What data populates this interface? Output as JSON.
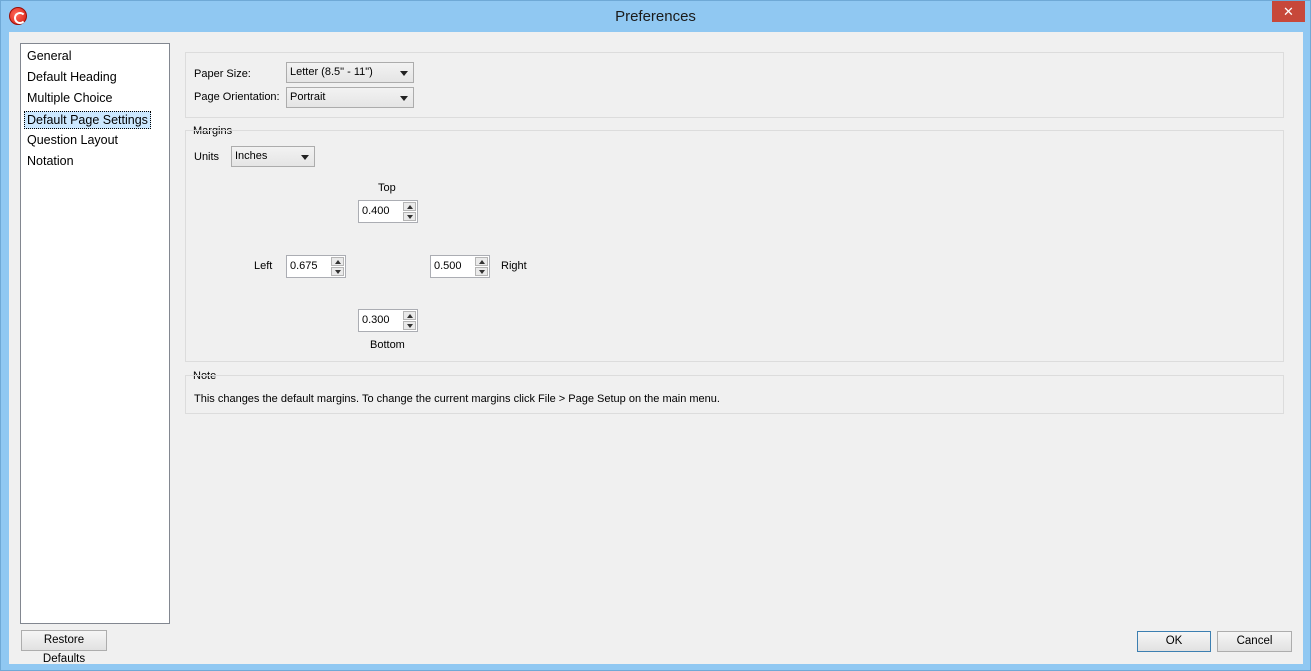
{
  "window": {
    "title": "Preferences",
    "close_glyph": "✕"
  },
  "sidebar": {
    "items": [
      {
        "label": "General"
      },
      {
        "label": "Default Heading"
      },
      {
        "label": "Multiple Choice"
      },
      {
        "label": "Default Page Settings",
        "selected": true
      },
      {
        "label": "Question Layout"
      },
      {
        "label": "Notation"
      }
    ]
  },
  "page": {
    "paper_size_label": "Paper Size:",
    "paper_size_value": "Letter (8.5\" - 11\")",
    "orientation_label": "Page Orientation:",
    "orientation_value": "Portrait"
  },
  "margins": {
    "group_title": "Margins",
    "units_label": "Units",
    "units_value": "Inches",
    "top_label": "Top",
    "top_value": "0.400",
    "left_label": "Left",
    "left_value": "0.675",
    "right_label": "Right",
    "right_value": "0.500",
    "bottom_label": "Bottom",
    "bottom_value": "0.300"
  },
  "note": {
    "title": "Note",
    "text": "This changes the default margins.  To change the current margins click File > Page Setup on the main menu."
  },
  "buttons": {
    "restore_defaults": "Restore Defaults",
    "ok": "OK",
    "cancel": "Cancel"
  },
  "icons": {
    "app": "app-logo-icon",
    "close": "close-icon",
    "dropdown": "chevron-down-icon",
    "spin_up": "spin-up-icon",
    "spin_down": "spin-down-icon"
  }
}
